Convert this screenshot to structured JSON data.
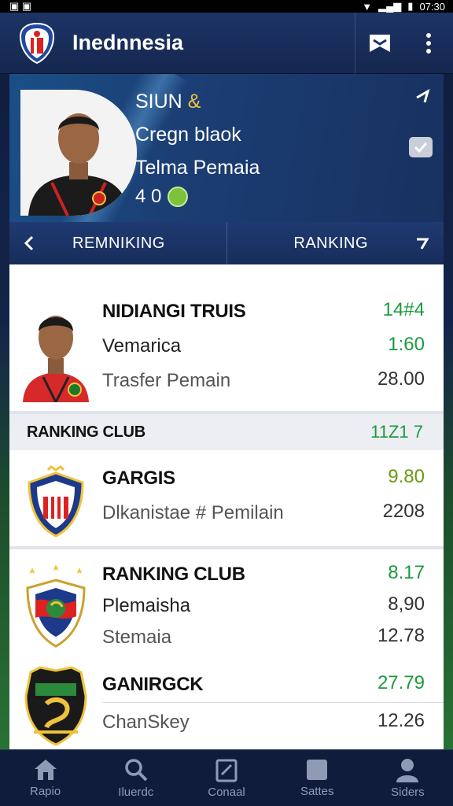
{
  "status_bar": {
    "time": "07:30"
  },
  "app": {
    "title": "Inednnesia"
  },
  "hero": {
    "line1_main": "SIUN",
    "line1_accent": "&",
    "line2": "Cregn blaok",
    "line3": "Telma Pemaia",
    "stat": "4 0"
  },
  "tabs": {
    "left_label": "REMNIKING",
    "right_label": "RANKING"
  },
  "player_row": {
    "name": "NIDIANGI TRUIS",
    "position": "Vemarica",
    "subtitle": "Trasfer Pemain",
    "v1": "14#4",
    "v2": "1:60",
    "v3": "28.00"
  },
  "section": {
    "label": "RANKING CLUB",
    "value": "11Z1 7"
  },
  "clubs": [
    {
      "name": "GARGIS",
      "subtitle": "Dlkanistae # Pemilain",
      "v1": "9.80",
      "v2": "2208"
    },
    {
      "name": "RANKING CLUB",
      "line2": "Plemaisha",
      "subtitle": "Stemaia",
      "v1": "8.17",
      "v2": "8,90",
      "v3": "12.78"
    },
    {
      "name": "GANIRGCK",
      "subtitle": "ChanSkey",
      "v1": "27.79",
      "v2": "12.26"
    }
  ],
  "bottom_nav": [
    {
      "label": "Rapio",
      "icon": "home-icon"
    },
    {
      "label": "Iluerdc",
      "icon": "search-icon"
    },
    {
      "label": "Conaal",
      "icon": "edit-icon"
    },
    {
      "label": "Sattes",
      "icon": "square-icon"
    },
    {
      "label": "Siders",
      "icon": "user-icon"
    }
  ],
  "colors": {
    "primary": "#14274f",
    "accent_green": "#1c9a3e",
    "accent_gold": "#f0c23c"
  }
}
